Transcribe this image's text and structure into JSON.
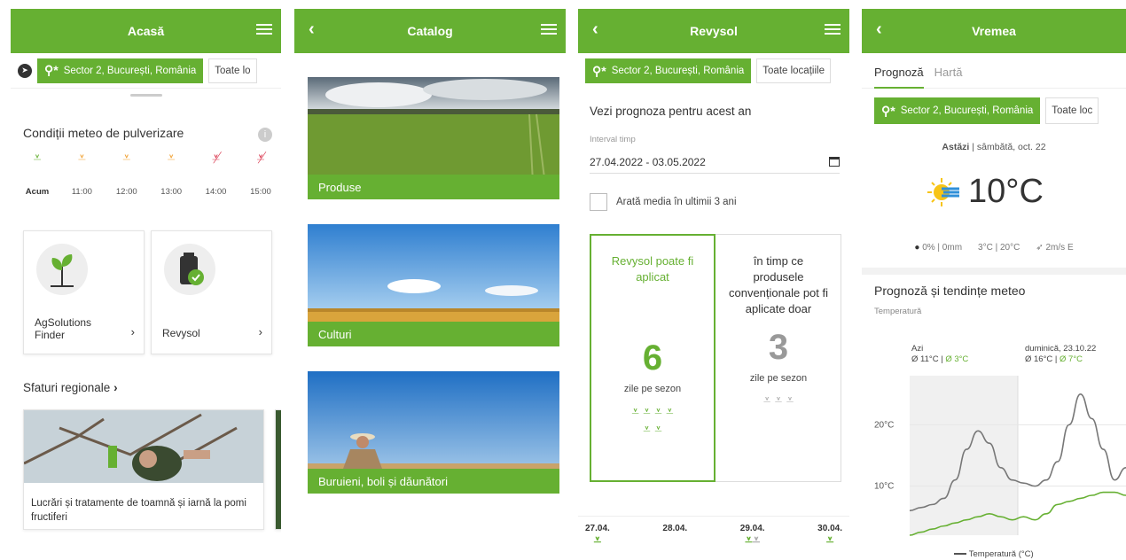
{
  "colors": {
    "brand": "#66b032",
    "orange": "#f0a030",
    "red": "#d9344b"
  },
  "screen1": {
    "title": "Acasă",
    "location": "Sector 2, București, România",
    "all_locations": "Toate lo",
    "spray_title": "Condiții meteo de pulverizare",
    "slots": [
      {
        "time": "Acum",
        "status": "green"
      },
      {
        "time": "11:00",
        "status": "orange"
      },
      {
        "time": "12:00",
        "status": "orange"
      },
      {
        "time": "13:00",
        "status": "orange"
      },
      {
        "time": "14:00",
        "status": "red"
      },
      {
        "time": "15:00",
        "status": "red"
      }
    ],
    "tiles": [
      {
        "label": "AgSolutions Finder"
      },
      {
        "label": "Revysol"
      }
    ],
    "advice_title": "Sfaturi regionale",
    "advice_text": "Lucrări și tratamente de toamnă și iarnă la pomi fructiferi"
  },
  "screen2": {
    "title": "Catalog",
    "cards": [
      {
        "label": "Produse"
      },
      {
        "label": "Culturi"
      },
      {
        "label": "Buruieni, boli și dăunători"
      }
    ]
  },
  "screen3": {
    "title": "Revysol",
    "location": "Sector 2, București, România",
    "all_locations": "Toate locațiile",
    "forecast_heading": "Vezi prognoza pentru acest an",
    "interval_label": "Interval timp",
    "interval_value": "27.04.2022 - 03.05.2022",
    "checkbox_label": "Arată media în ultimii 3 ani",
    "left_title": "Revysol poate fi aplicat",
    "left_number": "6",
    "left_unit": "zile pe sezon",
    "right_title": "în timp ce produsele convenționale pot fi aplicate doar",
    "right_number": "3",
    "right_unit": "zile pe sezon",
    "dates": [
      "27.04.",
      "28.04.",
      "29.04.",
      "30.04."
    ]
  },
  "screen4": {
    "title": "Vremea",
    "tabs": [
      "Prognoză",
      "Hartă"
    ],
    "location": "Sector 2, București, România",
    "all_locations": "Toate loc",
    "today_label": "Astăzi",
    "today_date": "| sâmbătă, oct. 22",
    "temperature": "10°C",
    "precip": "0% | 0mm",
    "minmax": "3°C | 20°C",
    "wind": "2m/s E",
    "trend_title": "Prognoză și tendințe meteo",
    "trend_sub": "Temperatură",
    "day1_name": "Azi",
    "day1_vals": "Ø 11°C |",
    "day1_low": "Ø 3°C",
    "day2_name": "duminică, 23.10.22",
    "day2_vals": "Ø 16°C |",
    "day2_low": "Ø 7°C",
    "legend": "Temperatură (°C)"
  },
  "chart_data": {
    "type": "line",
    "title": "Prognoză și tendințe meteo",
    "ylabel": "Temperatură",
    "y_ticks": [
      "20°C",
      "10°C"
    ],
    "ylim": [
      2,
      28
    ],
    "series": [
      {
        "name": "Temperatură (°C)",
        "color": "#777777",
        "values": [
          6,
          6.5,
          7,
          8,
          11,
          16,
          19,
          17,
          13,
          11,
          10.5,
          10,
          11,
          14,
          20,
          25,
          21,
          16,
          11,
          13
        ]
      },
      {
        "color": "#66b032",
        "values": [
          2,
          2.5,
          3,
          3.5,
          4,
          4.5,
          5,
          5.5,
          5,
          4.5,
          5,
          4.5,
          5.5,
          7,
          7.5,
          8,
          8.5,
          9,
          9,
          8.5
        ]
      }
    ]
  }
}
